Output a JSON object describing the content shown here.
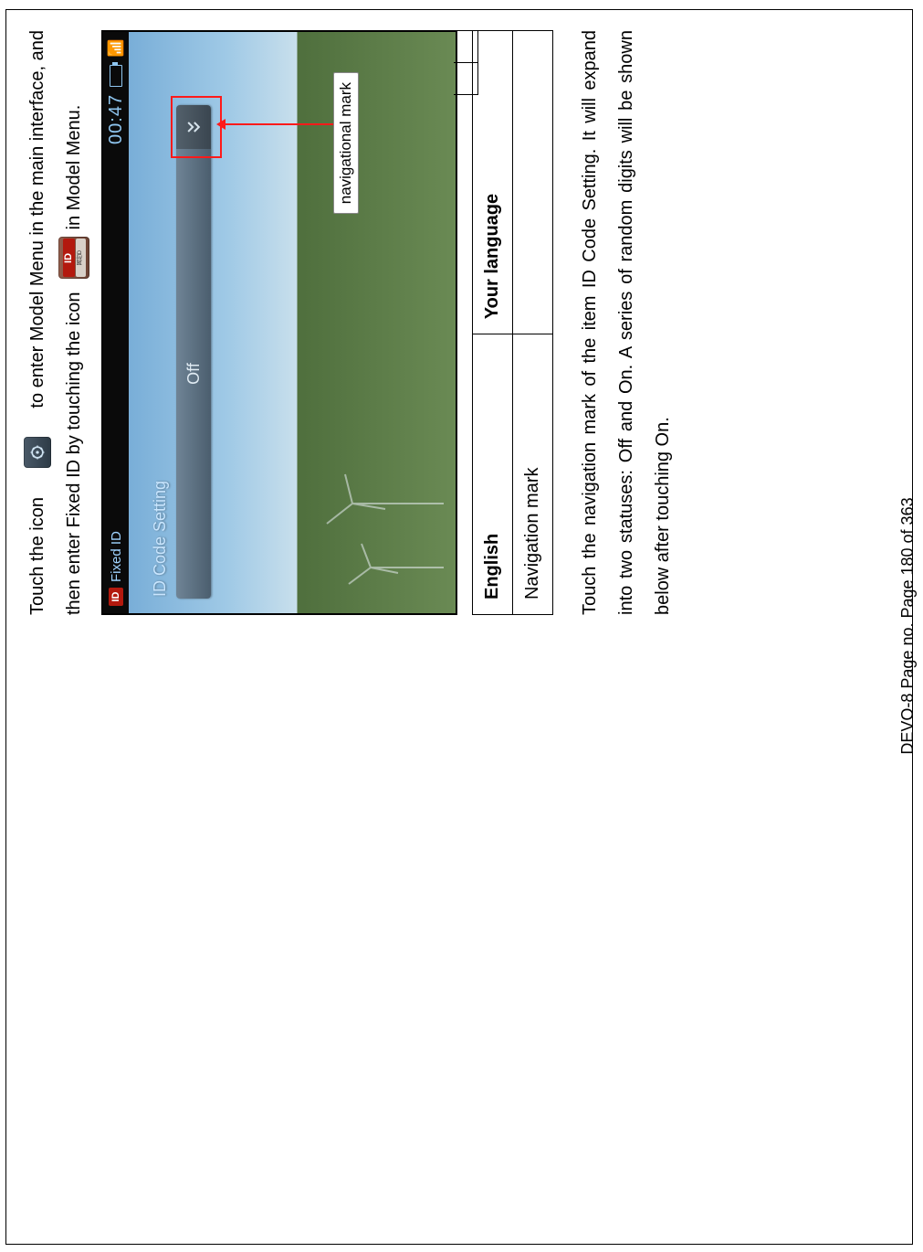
{
  "intro": {
    "line1_a": "Touch the icon",
    "line1_b": "to enter Model Menu in the main interface, and",
    "line2_a": "then enter Fixed ID by touching the icon",
    "line2_b": "in Model Menu."
  },
  "icons": {
    "model_menu": "model-menu-icon",
    "fixed_id": "fixed-id-icon",
    "fixed_id_top": "ID",
    "fixed_id_bot": "固定ID"
  },
  "screenshot": {
    "topbar_title": "Fixed ID",
    "clock": "00:47",
    "row_label": "ID Code Setting",
    "row_value": "Off",
    "callout": "navigational mark"
  },
  "table": {
    "hdr_en": "English",
    "hdr_other": "Your language",
    "r1_en": "Navigation mark",
    "r1_other": ""
  },
  "body_para": "Touch the navigation mark of the item ID Code Setting. It will expand into two statuses: Off and On. A series of random digits will be shown below after touching On.",
  "footer": "DEVO-8    Page no. Page 180 of 363"
}
